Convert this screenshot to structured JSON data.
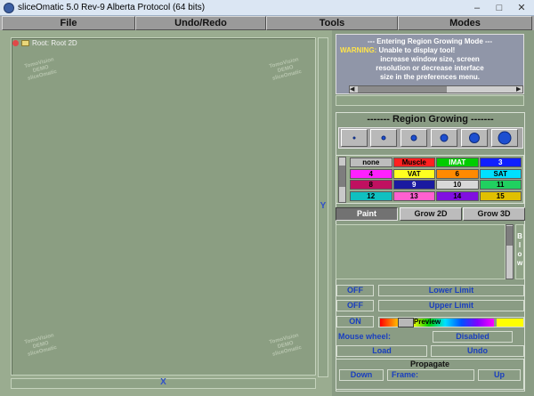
{
  "window": {
    "title": "sliceOmatic 5.0 Rev-9 Alberta Protocol (64 bits)",
    "minimize": "–",
    "maximize": "□",
    "close": "✕"
  },
  "menu": {
    "file": "File",
    "undo_redo": "Undo/Redo",
    "tools": "Tools",
    "modes": "Modes"
  },
  "tree": {
    "root_label": "Root: Root 2D"
  },
  "watermark": {
    "line1": "TomoVision",
    "line2": "DEMO",
    "line3": "sliceOmatic"
  },
  "axes": {
    "vertical": "Y",
    "horizontal": "X"
  },
  "messages": {
    "line1": "--- Entering Region Growing Mode ---",
    "warning_prefix": "WARNING:",
    "warning_rest": " Unable to display tool!",
    "line3": "increase window size, screen",
    "line4": "resolution or decrease interface",
    "line5": "size in the preferences menu."
  },
  "region_growing": {
    "title": "------- Region Growing -------",
    "labels": [
      {
        "text": "none",
        "bg": "#bdbdbd",
        "fg": "#000000"
      },
      {
        "text": "Muscle",
        "bg": "#ff2020",
        "fg": "#000000"
      },
      {
        "text": "IMAT",
        "bg": "#00cc00",
        "fg": "#ffffff"
      },
      {
        "text": "3",
        "bg": "#1020ff",
        "fg": "#ffffff"
      },
      {
        "text": "4",
        "bg": "#ff20ff",
        "fg": "#000000"
      },
      {
        "text": "VAT",
        "bg": "#ffff20",
        "fg": "#000000"
      },
      {
        "text": "6",
        "bg": "#ff8a00",
        "fg": "#000000"
      },
      {
        "text": "SAT",
        "bg": "#00e0ff",
        "fg": "#000000"
      },
      {
        "text": "8",
        "bg": "#c01060",
        "fg": "#000000"
      },
      {
        "text": "9",
        "bg": "#1a1aa0",
        "fg": "#ffffff"
      },
      {
        "text": "10",
        "bg": "#d8d8d8",
        "fg": "#000000"
      },
      {
        "text": "11",
        "bg": "#20d060",
        "fg": "#000000"
      },
      {
        "text": "12",
        "bg": "#10c0c0",
        "fg": "#000000"
      },
      {
        "text": "13",
        "bg": "#ff60d0",
        "fg": "#000000"
      },
      {
        "text": "14",
        "bg": "#8010e0",
        "fg": "#000000"
      },
      {
        "text": "15",
        "bg": "#e0c000",
        "fg": "#000000"
      }
    ],
    "tabs": {
      "paint": "Paint",
      "grow2d": "Grow 2D",
      "grow3d": "Grow 3D"
    },
    "blow_label": "Blow",
    "lower": {
      "state": "OFF",
      "label": "Lower Limit"
    },
    "upper": {
      "state": "OFF",
      "label": "Upper Limit"
    },
    "preview": {
      "state": "ON",
      "label": "Preview"
    },
    "mouse_wheel": {
      "label": "Mouse wheel:",
      "value": "Disabled"
    },
    "load": "Load",
    "undo": "Undo",
    "propagate": {
      "title": "Propagate",
      "down": "Down",
      "frame": "Frame:",
      "up": "Up"
    }
  }
}
